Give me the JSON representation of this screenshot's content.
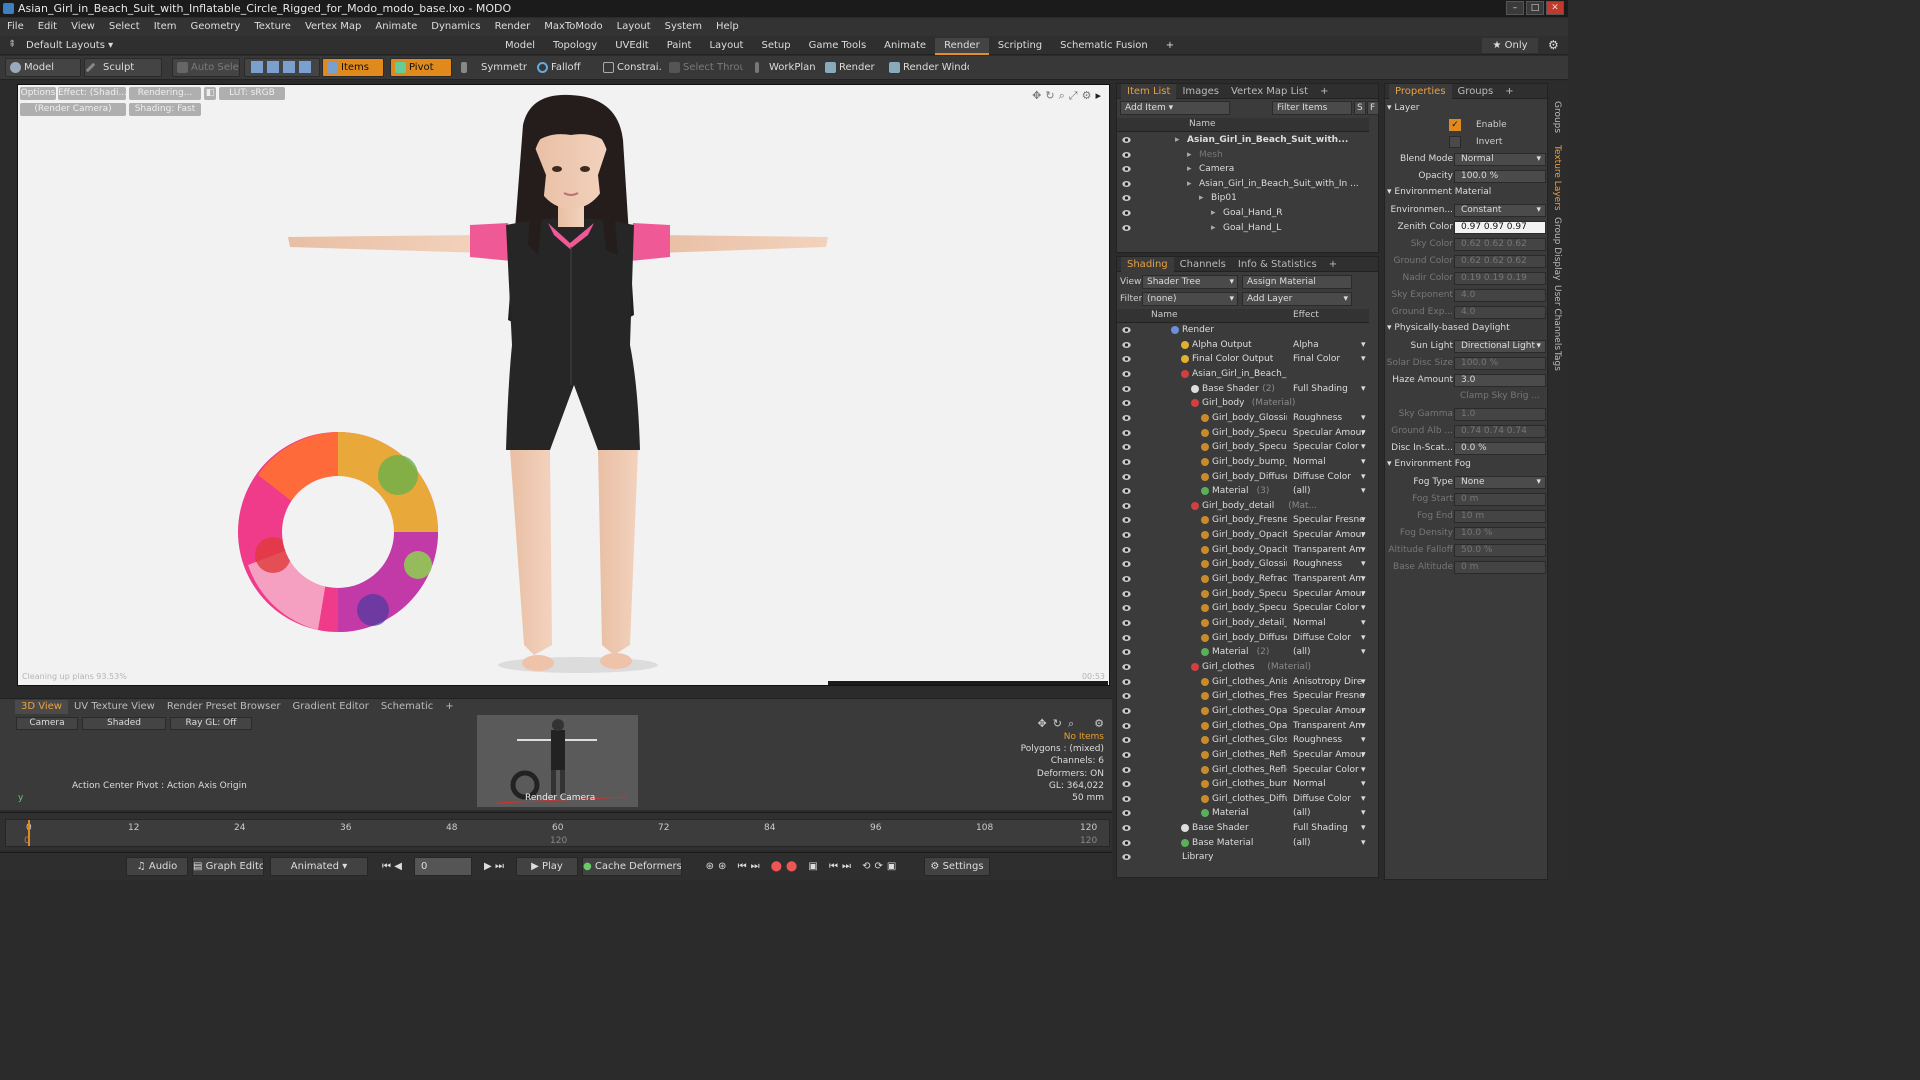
{
  "window": {
    "title": "Asian_Girl_in_Beach_Suit_with_Inflatable_Circle_Rigged_for_Modo_modo_base.lxo - MODO"
  },
  "menu": [
    "File",
    "Edit",
    "View",
    "Select",
    "Item",
    "Geometry",
    "Texture",
    "Vertex Map",
    "Animate",
    "Dynamics",
    "Render",
    "MaxToModo",
    "Layout",
    "System",
    "Help"
  ],
  "layout_bar": {
    "selector": "Default Layouts ▾",
    "tabs": [
      "Model",
      "Topology",
      "UVEdit",
      "Paint",
      "Layout",
      "Setup",
      "Game Tools",
      "Animate",
      "Render",
      "Scripting",
      "Schematic Fusion",
      "+"
    ],
    "active_tab": "Render",
    "only": "★ Only"
  },
  "toolbar": {
    "model": "Model",
    "sculpt": "Sculpt",
    "auto_select": "Auto Select",
    "items": "Items",
    "pivot": "Pivot",
    "symmetry": "Symmetry",
    "falloff": "Falloff",
    "constraints": "Constrai...",
    "select_through": "Select Through",
    "workplane": "WorkPlane",
    "render": "Render",
    "render_window": "Render Window"
  },
  "viewport": {
    "options": "Options",
    "effect": "Effect: (Shadi...",
    "rendering": "Rendering...",
    "lut": "LUT: sRGB",
    "camera": "(Render Camera)",
    "shading": "Shading: Fast",
    "status": "Cleaning up plans 93.53%",
    "time": "00:53"
  },
  "bottom_panel": {
    "tabs": [
      "3D View",
      "UV Texture View",
      "Render Preset Browser",
      "Gradient Editor",
      "Schematic",
      "+"
    ],
    "camera": "Camera",
    "shaded": "Shaded",
    "raygl": "Ray GL: Off",
    "action_center": "Action Center Pivot : Action Axis Origin",
    "thumb_label": "Render Camera",
    "stats": [
      "No Items",
      "Polygons : (mixed)",
      "Channels: 6",
      "Deformers: ON",
      "GL: 364,022",
      "50 mm"
    ]
  },
  "timeline": {
    "ticks": [
      "0",
      "12",
      "24",
      "36",
      "48",
      "60",
      "72",
      "84",
      "96",
      "108",
      "120"
    ],
    "sub_ticks": [
      "0",
      "120",
      "120"
    ]
  },
  "transport": {
    "audio": "Audio",
    "graph_editor": "Graph Editor",
    "animated": "Animated",
    "frame": "0",
    "play": "Play",
    "cache": "Cache Deformers",
    "settings": "Settings"
  },
  "item_list": {
    "tabs": [
      "Item List",
      "Images",
      "Vertex Map List",
      "+"
    ],
    "add_item": "Add Item",
    "filter_items": "Filter Items",
    "col_name": "Name",
    "rows": [
      {
        "label": "Asian_Girl_in_Beach_Suit_with...",
        "indent": 0,
        "bold": true
      },
      {
        "label": "Mesh",
        "indent": 1,
        "dim": true
      },
      {
        "label": "Camera",
        "indent": 1
      },
      {
        "label": "Asian_Girl_in_Beach_Suit_with_In ...",
        "indent": 1
      },
      {
        "label": "Bip01",
        "indent": 2
      },
      {
        "label": "Goal_Hand_R",
        "indent": 3
      },
      {
        "label": "Goal_Hand_L",
        "indent": 3
      }
    ]
  },
  "shading": {
    "tabs": [
      "Shading",
      "Channels",
      "Info & Statistics",
      "+"
    ],
    "view_label": "View",
    "view_value": "Shader Tree",
    "assign_material": "Assign Material",
    "filter_label": "Filter",
    "filter_value": "(none)",
    "add_layer": "Add Layer",
    "col_name": "Name",
    "col_effect": "Effect",
    "rows": [
      {
        "name": "Render",
        "suffix": "",
        "effect": "",
        "indent": 0,
        "color": "#6c8fd8"
      },
      {
        "name": "Alpha Output",
        "suffix": "",
        "effect": "Alpha",
        "indent": 1,
        "color": "#e0b030"
      },
      {
        "name": "Final Color Output",
        "suffix": "",
        "effect": "Final Color",
        "indent": 1,
        "color": "#e0b030"
      },
      {
        "name": "Asian_Girl_in_Beach_Sui...",
        "suffix": "",
        "effect": "",
        "indent": 1,
        "color": "#d04040"
      },
      {
        "name": "Base Shader",
        "suffix": "(2)",
        "effect": "Full Shading",
        "indent": 2,
        "color": "#dddddd"
      },
      {
        "name": "Girl_body",
        "suffix": "(Material)",
        "effect": "",
        "indent": 2,
        "color": "#d04040"
      },
      {
        "name": "Girl_body_Glossine ...",
        "suffix": "",
        "effect": "Roughness",
        "indent": 3,
        "color": "#c98a2c"
      },
      {
        "name": "Girl_body_Specular...",
        "suffix": "",
        "effect": "Specular Amount",
        "indent": 3,
        "color": "#c98a2c"
      },
      {
        "name": "Girl_body_Specular...",
        "suffix": "",
        "effect": "Specular Color",
        "indent": 3,
        "color": "#c98a2c"
      },
      {
        "name": "Girl_body_bump_b ...",
        "suffix": "",
        "effect": "Normal",
        "indent": 3,
        "color": "#c98a2c"
      },
      {
        "name": "Girl_body_Diffuse (...",
        "suffix": "",
        "effect": "Diffuse Color",
        "indent": 3,
        "color": "#c98a2c"
      },
      {
        "name": "Material",
        "suffix": "(3)",
        "effect": "(all)",
        "indent": 3,
        "color": "#5ab05a"
      },
      {
        "name": "Girl_body_detail",
        "suffix": "(Mat...",
        "effect": "",
        "indent": 2,
        "color": "#d04040"
      },
      {
        "name": "Girl_body_Fresnel",
        "suffix": "",
        "effect": "Specular Fresnel",
        "indent": 3,
        "color": "#c98a2c"
      },
      {
        "name": "Girl_body_Opacity",
        "suffix": "",
        "effect": "Specular Amount",
        "indent": 3,
        "color": "#c98a2c"
      },
      {
        "name": "Girl_body_Opacity",
        "suffix": "",
        "effect": "Transparent Am...",
        "indent": 3,
        "color": "#c98a2c"
      },
      {
        "name": "Girl_body_Glossine ...",
        "suffix": "",
        "effect": "Roughness",
        "indent": 3,
        "color": "#c98a2c"
      },
      {
        "name": "Girl_body_Refracti ...",
        "suffix": "",
        "effect": "Transparent Am...",
        "indent": 3,
        "color": "#c98a2c"
      },
      {
        "name": "Girl_body_Specular...",
        "suffix": "",
        "effect": "Specular Amount",
        "indent": 3,
        "color": "#c98a2c"
      },
      {
        "name": "Girl_body_Specular...",
        "suffix": "",
        "effect": "Specular Color",
        "indent": 3,
        "color": "#c98a2c"
      },
      {
        "name": "Girl_body_detail_b ...",
        "suffix": "",
        "effect": "Normal",
        "indent": 3,
        "color": "#c98a2c"
      },
      {
        "name": "Girl_body_Diffuse (...",
        "suffix": "",
        "effect": "Diffuse Color",
        "indent": 3,
        "color": "#c98a2c"
      },
      {
        "name": "Material",
        "suffix": "(2)",
        "effect": "(all)",
        "indent": 3,
        "color": "#5ab05a"
      },
      {
        "name": "Girl_clothes",
        "suffix": "(Material)",
        "effect": "",
        "indent": 2,
        "color": "#d04040"
      },
      {
        "name": "Girl_clothes_Anisot ...",
        "suffix": "",
        "effect": "Anisotropy Dire ...",
        "indent": 3,
        "color": "#c98a2c"
      },
      {
        "name": "Girl_clothes_Fresn ...",
        "suffix": "",
        "effect": "Specular Fresnel",
        "indent": 3,
        "color": "#c98a2c"
      },
      {
        "name": "Girl_clothes_Opacit...",
        "suffix": "",
        "effect": "Specular Amount",
        "indent": 3,
        "color": "#c98a2c"
      },
      {
        "name": "Girl_clothes_Opacit...",
        "suffix": "",
        "effect": "Transparent Am...",
        "indent": 3,
        "color": "#c98a2c"
      },
      {
        "name": "Girl_clothes_Glossi ...",
        "suffix": "",
        "effect": "Roughness",
        "indent": 3,
        "color": "#c98a2c"
      },
      {
        "name": "Girl_clothes_Reflec...",
        "suffix": "",
        "effect": "Specular Amount",
        "indent": 3,
        "color": "#c98a2c"
      },
      {
        "name": "Girl_clothes_Reflec...",
        "suffix": "",
        "effect": "Specular Color",
        "indent": 3,
        "color": "#c98a2c"
      },
      {
        "name": "Girl_clothes_bump_...",
        "suffix": "",
        "effect": "Normal",
        "indent": 3,
        "color": "#c98a2c"
      },
      {
        "name": "Girl_clothes_Diffus ...",
        "suffix": "",
        "effect": "Diffuse Color",
        "indent": 3,
        "color": "#c98a2c"
      },
      {
        "name": "Material",
        "suffix": "",
        "effect": "(all)",
        "indent": 3,
        "color": "#5ab05a"
      },
      {
        "name": "Base Shader",
        "suffix": "",
        "effect": "Full Shading",
        "indent": 1,
        "color": "#dddddd"
      },
      {
        "name": "Base Material",
        "suffix": "",
        "effect": "(all)",
        "indent": 1,
        "color": "#5ab05a"
      },
      {
        "name": "Library",
        "suffix": "",
        "effect": "",
        "indent": 0,
        "color": ""
      }
    ]
  },
  "properties": {
    "tabs": [
      "Properties",
      "Groups",
      "+"
    ],
    "layer": "Layer",
    "enable": "Enable",
    "invert": "Invert",
    "rows": [
      {
        "label": "Blend Mode",
        "value": "Normal",
        "dim": false,
        "dropdown": true
      },
      {
        "label": "Opacity",
        "value": "100.0 %",
        "dim": false
      },
      {
        "section": "Environment Material"
      },
      {
        "label": "Environmen...",
        "value": "Constant",
        "dim": false,
        "dropdown": true
      },
      {
        "label": "Zenith Color",
        "value": "0.97  0.97  0.97",
        "dim": false,
        "white": true
      },
      {
        "label": "Sky Color",
        "value": "0.62  0.62  0.62",
        "dim": true
      },
      {
        "label": "Ground Color",
        "value": "0.62  0.62  0.62",
        "dim": true
      },
      {
        "label": "Nadir Color",
        "value": "0.19  0.19  0.19",
        "dim": true
      },
      {
        "label": "Sky Exponent",
        "value": "4.0",
        "dim": true
      },
      {
        "label": "Ground Exp...",
        "value": "4.0",
        "dim": true
      },
      {
        "section": "Physically-based Daylight"
      },
      {
        "label": "Sun Light",
        "value": "Directional Light",
        "dim": false,
        "dropdown": true
      },
      {
        "label": "Solar Disc Size",
        "value": "100.0 %",
        "dim": true
      },
      {
        "label": "Haze Amount",
        "value": "3.0",
        "dim": false
      },
      {
        "label": "",
        "value": "Clamp Sky Brig ...",
        "dim": true,
        "check": true
      },
      {
        "label": "Sky Gamma",
        "value": "1.0",
        "dim": true
      },
      {
        "label": "Ground Alb ...",
        "value": "0.74  0.74  0.74",
        "dim": true
      },
      {
        "label": "Disc In-Scat...",
        "value": "0.0 %",
        "dim": false
      },
      {
        "section": "Environment Fog"
      },
      {
        "label": "Fog Type",
        "value": "None",
        "dim": false,
        "dropdown": true
      },
      {
        "label": "Fog Start",
        "value": "0 m",
        "dim": true
      },
      {
        "label": "Fog End",
        "value": "10 m",
        "dim": true
      },
      {
        "label": "Fog Density",
        "value": "10.0 %",
        "dim": true
      },
      {
        "label": "Altitude Falloff",
        "value": "50.0 %",
        "dim": true
      },
      {
        "label": "Base Altitude",
        "value": "0 m",
        "dim": true
      }
    ]
  },
  "side_tabs": [
    "Groups",
    "Texture Layers",
    "Group Display",
    "User Channels",
    "Tags"
  ],
  "colors": {
    "accent": "#e08a1e",
    "panel": "#3b3b3b",
    "viewport_bg": "#f2f2f2"
  }
}
